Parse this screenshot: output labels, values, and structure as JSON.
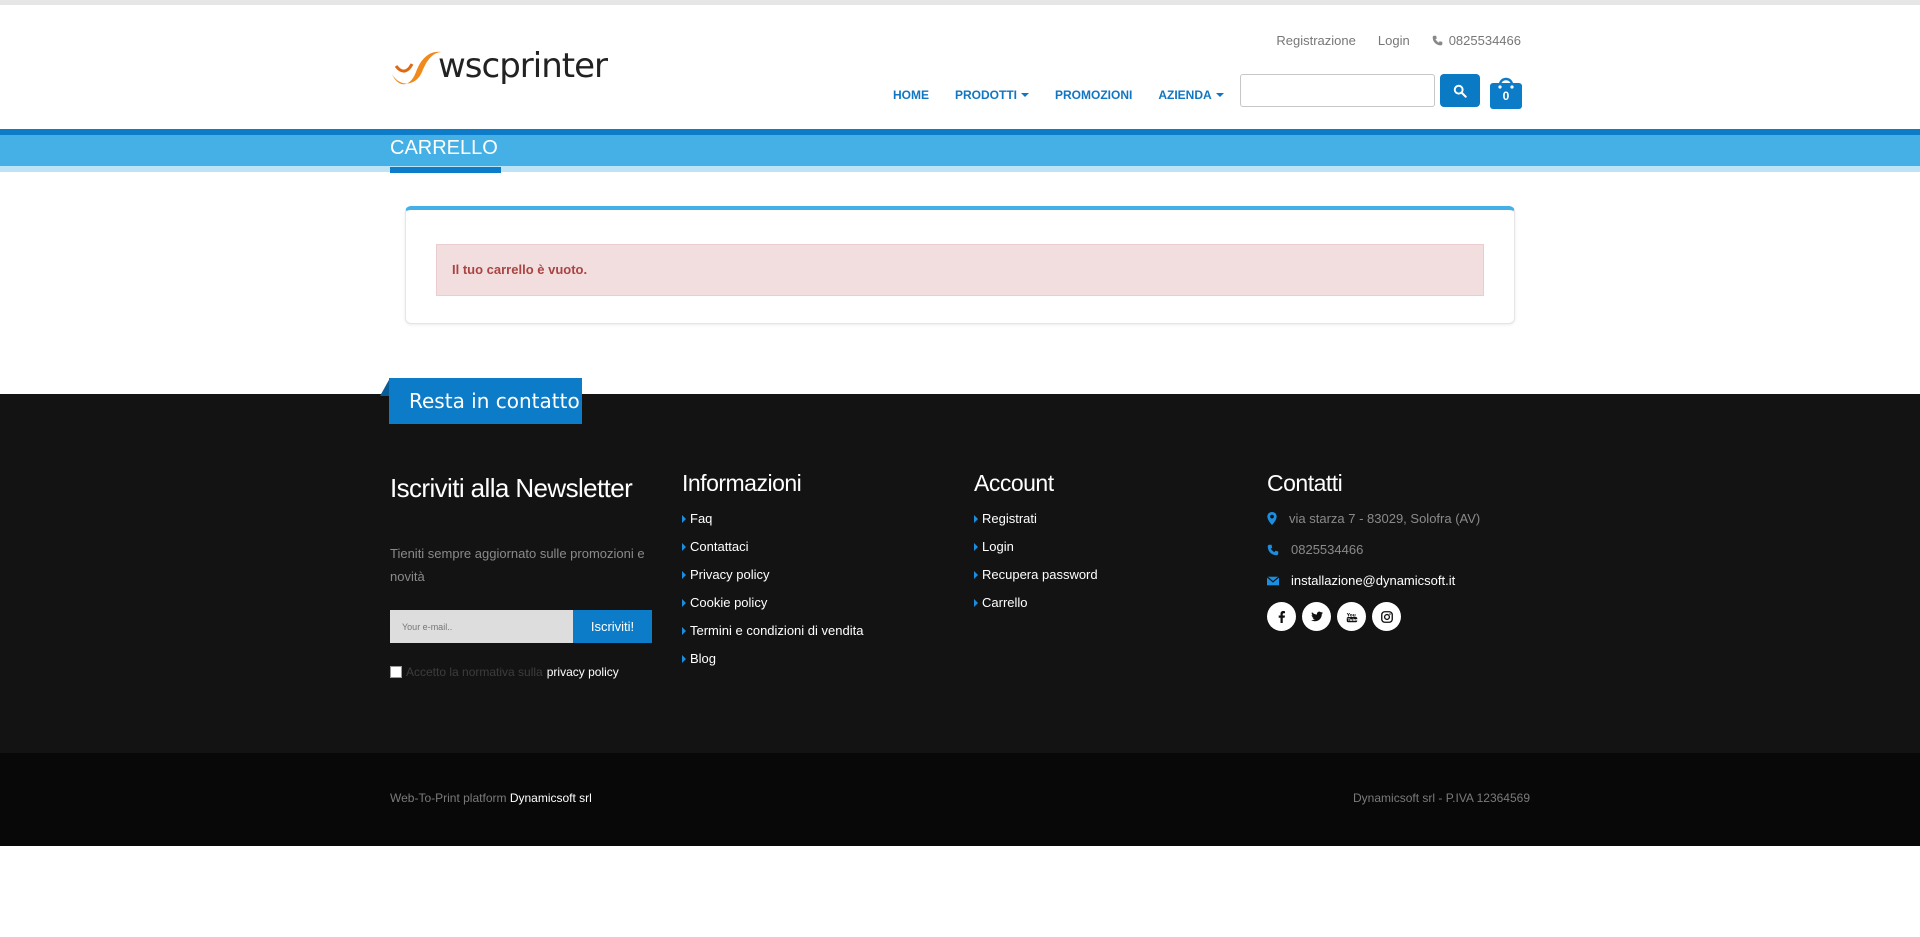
{
  "header": {
    "logo_text": "wscprinter",
    "top_links": {
      "register": "Registrazione",
      "login": "Login",
      "phone": "0825534466"
    },
    "nav": {
      "home": "HOME",
      "products": "PRODOTTI",
      "promotions": "PROMOZIONI",
      "company": "AZIENDA"
    },
    "search": {
      "placeholder": ""
    },
    "cart_count": "0"
  },
  "page": {
    "title": "CARRELLO",
    "alert": "Il tuo carrello è vuoto."
  },
  "footer": {
    "contact_tab": "Resta in contatto",
    "newsletter": {
      "title": "Iscriviti alla Newsletter",
      "text": "Tieniti sempre aggiornato sulle promozioni e novità",
      "email_placeholder": "Your e-mail..",
      "button": "Iscriviti!",
      "privacy_prefix": "Accetto la normativa sulla",
      "privacy_link": "privacy policy"
    },
    "info": {
      "title": "Informazioni",
      "items": [
        "Faq",
        "Contattaci",
        "Privacy policy",
        "Cookie policy",
        "Termini e condizioni di vendita",
        "Blog"
      ]
    },
    "account": {
      "title": "Account",
      "items": [
        "Registrati",
        "Login",
        "Recupera password",
        "Carrello"
      ]
    },
    "contacts": {
      "title": "Contatti",
      "address": "via starza 7 - 83029, Solofra (AV)",
      "phone": "0825534466",
      "email": "installazione@dynamicsoft.it",
      "socials": [
        "facebook-icon",
        "twitter-icon",
        "youtube-icon",
        "instagram-icon"
      ]
    },
    "bottom": {
      "platform_label": "Web-To-Print platform",
      "platform_brand": "Dynamicsoft srl",
      "company_info": "Dynamicsoft srl - P.IVA 12364569"
    }
  },
  "colors": {
    "primary": "#0c7cc9",
    "band": "#45b0e6",
    "alert_bg": "#f2dede",
    "alert_text": "#a94442",
    "footer_bg": "#131313"
  }
}
